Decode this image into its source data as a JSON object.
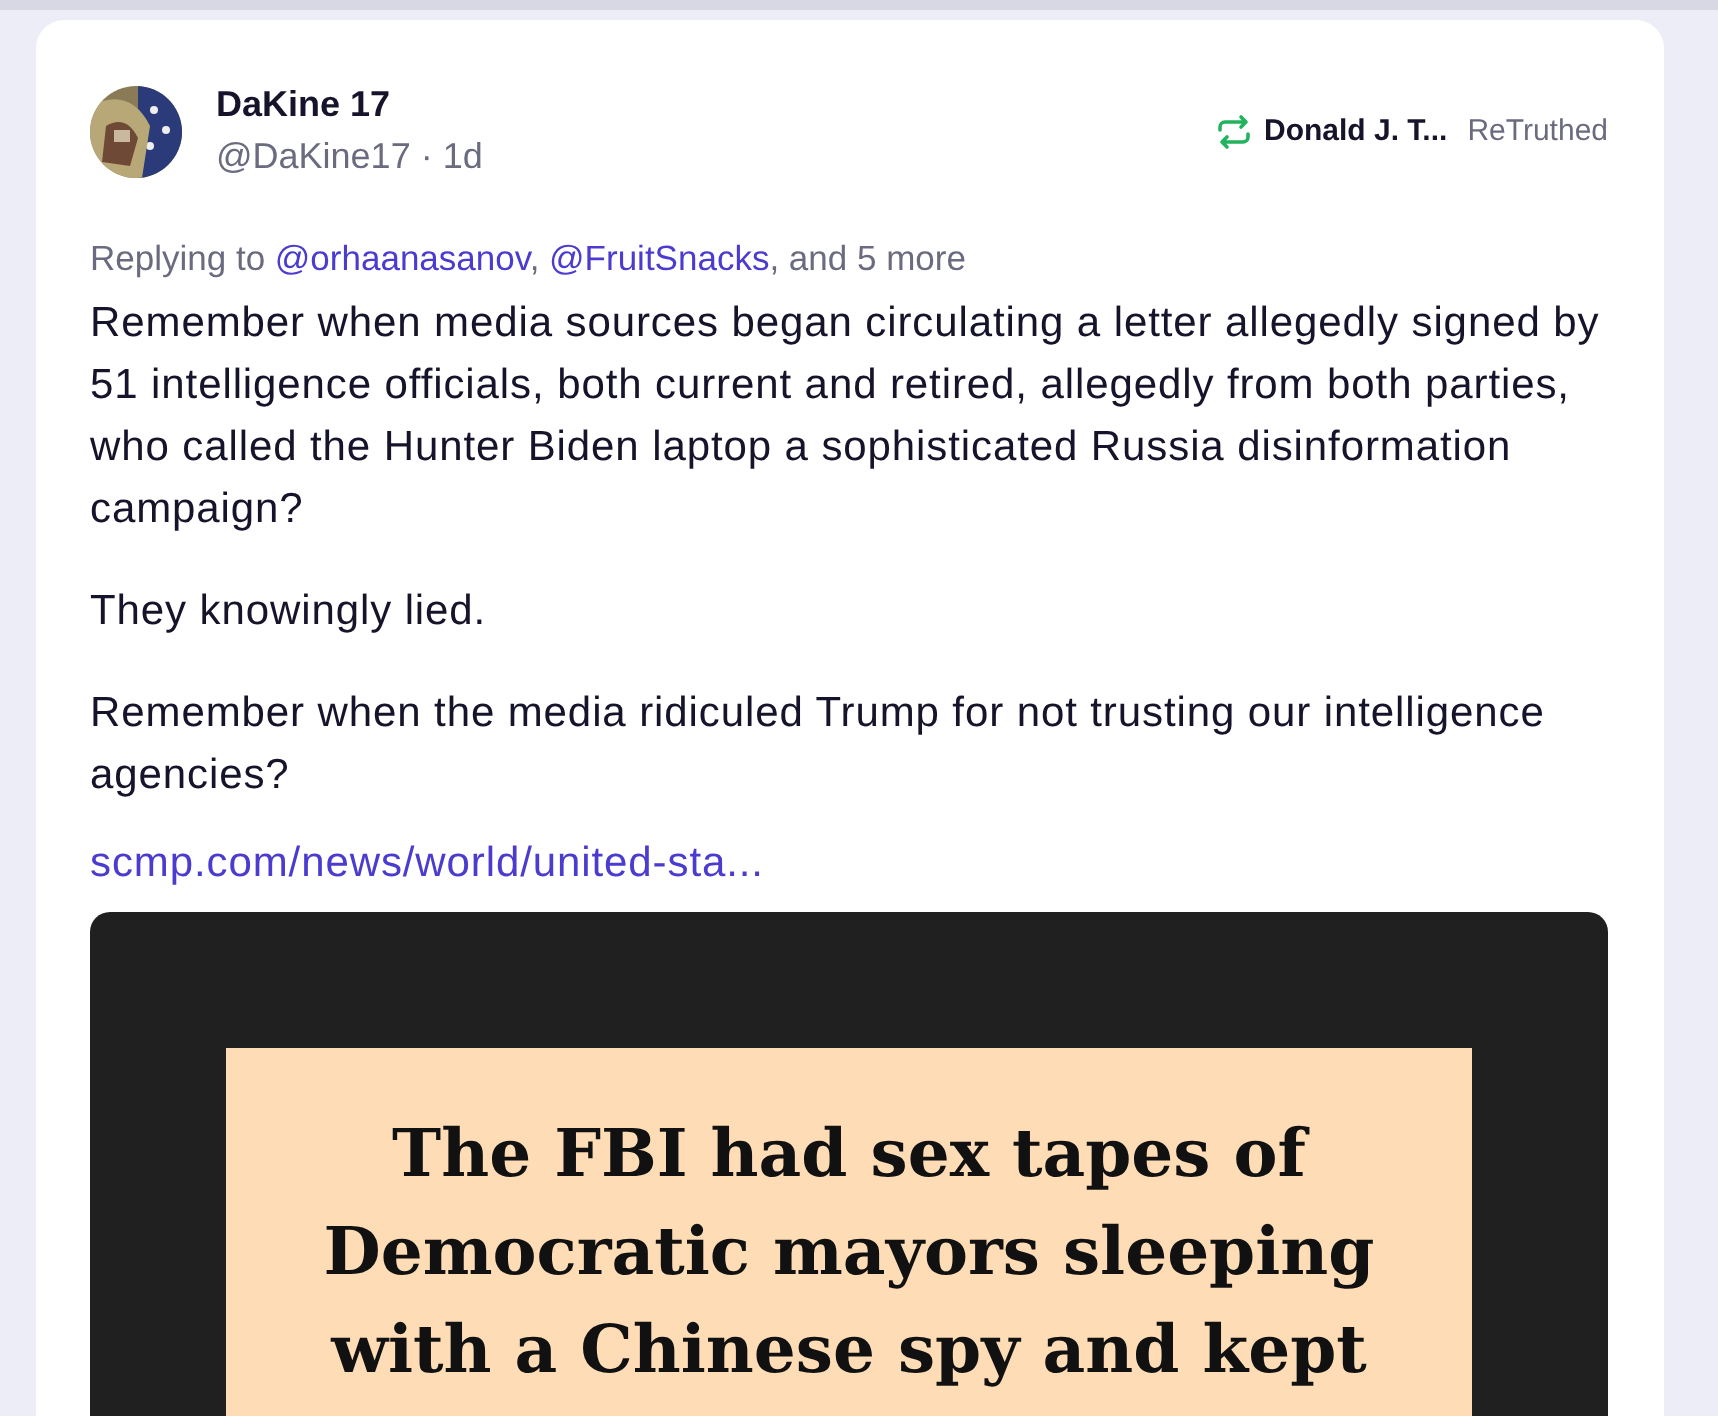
{
  "post": {
    "author": {
      "name": "DaKine 17",
      "handle": "@DaKine17",
      "separator": "·",
      "time": "1d"
    },
    "retruth": {
      "by": "Donald J. T...",
      "label": "ReTruthed"
    },
    "replying": {
      "prefix": "Replying to",
      "mentions": [
        {
          "text": "@orhaanasanov",
          "separator": ","
        },
        {
          "text": "@FruitSnacks"
        }
      ],
      "suffix": ", and 5 more"
    },
    "paragraphs": [
      "Remember when media sources began circulating a letter allegedly signed by 51 intelligence officials, both current and retired, allegedly from both parties, who called the Hunter Biden laptop a sophisticated Russia disinformation campaign?",
      "They knowingly lied.",
      "Remember when the media ridiculed Trump for not trusting our intelligence agencies?"
    ],
    "link": "scmp.com/news/world/united-sta...",
    "image": {
      "lines": [
        "The FBI had sex tapes of",
        "Democratic mayors sleeping",
        "with a Chinese spy and kept"
      ]
    }
  }
}
